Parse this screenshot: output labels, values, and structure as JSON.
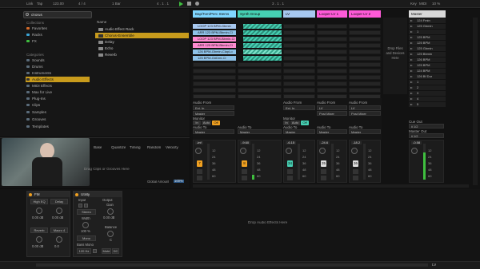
{
  "transport": {
    "link": "Link",
    "tap": "Tap",
    "tempo": "123.00",
    "signature": "4 / 4",
    "quantize": "1 Bar",
    "position": "4 . 1 . 1",
    "position2": "3 . 1 . 1",
    "key": "Key",
    "midi": "MIDI",
    "cpu": "10 %"
  },
  "browser": {
    "search_value": "chorus",
    "collections_header": "Collections",
    "collections": [
      "Favorites",
      "Racks",
      "FX"
    ],
    "categories_header": "Categories",
    "categories": [
      "Sounds",
      "Drums",
      "Instruments",
      "Audio Effects",
      "MIDI Effects",
      "Max for Live",
      "Plug-Ins",
      "Clips",
      "Samples",
      "Grooves",
      "Templates"
    ],
    "selected_category": "Audio Effects",
    "name_header": "Name",
    "files": [
      "Audio Effect Rack",
      "Chorus-Ensemble",
      "Delay",
      "Echo",
      "Reverb"
    ],
    "selected_file": "Chorus-Ensemble"
  },
  "groove": {
    "headers": [
      "Base",
      "Quantize",
      "Timing",
      "Random",
      "Velocity"
    ],
    "drop_text": "Drag Clips or Grooves Here",
    "global_amount_label": "Global Amount",
    "global_amount_value": "100%"
  },
  "tracks": [
    {
      "name": "Bap/Tom/Perc Stems",
      "color": "#7fd6ff",
      "number": "7",
      "vol": "-inf",
      "pan": "C"
    },
    {
      "name": "Synth Group",
      "color": "#46d0b3",
      "number": "8",
      "vol": "-9.60",
      "pan": "C"
    },
    {
      "name": "LV",
      "color": "#a7c8f0",
      "number": "34",
      "vol": "-6.15",
      "pan": "C"
    },
    {
      "name": "Looper LV 1",
      "color": "#ff5ad8",
      "number": "35",
      "vol": "-24.6",
      "pan": "C"
    },
    {
      "name": "Looper LV 2",
      "color": "#ff5ad8",
      "number": "36",
      "vol": "-18.2",
      "pan": "C"
    }
  ],
  "clips": [
    {
      "label": "LOOP 123 BPM-Gbmin",
      "color": "#a7c8f0"
    },
    {
      "label": "ARR 123 BPM-Bbmin-Cl",
      "color": "#8ec2e8"
    },
    {
      "label": "LOOP 123 BPM-Bbmin-Cl",
      "color": "#ff8ad0"
    },
    {
      "label": "ARR 125 BPM-Bbmin-Cl",
      "color": "#ff8ad0"
    },
    {
      "label": "126 BPM-Gbmin-ClapLo",
      "color": "#8ec2e8"
    },
    {
      "label": "125 BPM-G#Dmi-Cl",
      "color": "#8ec2e8"
    }
  ],
  "scene_panel": {
    "drop_text": "Drop Files and Devices Here"
  },
  "master": {
    "name": "Master",
    "scenes": [
      "124 Fmin",
      "125 Gbmin",
      "1",
      "125 BPM",
      "125 BPM",
      "125 Gbmin",
      "125 Bbmin",
      "126 BPM",
      "125 BPM",
      "124 BPM",
      "126 Bf Dur",
      "1",
      "2",
      "3",
      "4",
      "5"
    ],
    "cue_out_label": "Cue Out",
    "cue_out_value": "ii 1/2",
    "master_out_label": "Master Out",
    "master_out_value": "ii 1/2",
    "vol": "-0.58",
    "pan": "C"
  },
  "io": {
    "audio_from": "Audio From",
    "audio_to": "Audio To",
    "monitor": "Monitor",
    "in": "In",
    "auto": "Auto",
    "off": "Off",
    "master": "Master",
    "ext_in": "Ext. In",
    "post_mixer": "Post Mixer",
    "lv": "LV"
  },
  "devices": {
    "fm": {
      "title": "FM",
      "controls": [
        "High EQ",
        "Delay",
        "Reverb",
        "Macro 4"
      ],
      "values": [
        "0.00 dB",
        "0.00 dB",
        "0.00 dB",
        "0.0"
      ]
    },
    "utility": {
      "title": "Utility",
      "input_label": "Input",
      "output_label": "Output",
      "gain_label": "Gain",
      "gain_value": "0.00 dB",
      "stereo": "Stereo",
      "width_label": "Width",
      "width_value": "100 %",
      "mono": "Mono",
      "bass_mono": "Bass Mono",
      "bass_freq": "120 Hz",
      "balance_label": "Balance",
      "balance_value": "C",
      "mute": "Mute",
      "dc": "DC"
    },
    "drop_text": "Drop Audio Effects Here"
  },
  "status": {
    "track_label": "LV"
  },
  "colors": {
    "accent": "#c89b1c",
    "play_green": "#3fbf3f",
    "track_orange": "#f0a020",
    "track_cyan": "#46d0b3"
  }
}
